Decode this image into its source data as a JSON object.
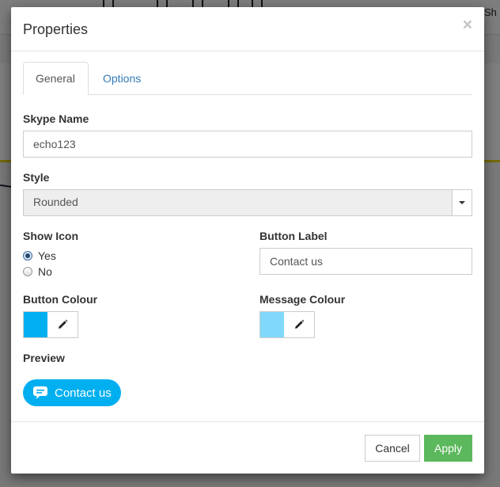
{
  "background": {
    "toolbar_share_text": "Sh"
  },
  "modal": {
    "title": "Properties",
    "close_label": "×",
    "tabs": [
      {
        "label": "General",
        "active": true
      },
      {
        "label": "Options",
        "active": false
      }
    ],
    "skype_name": {
      "label": "Skype Name",
      "value": "echo123"
    },
    "style": {
      "label": "Style",
      "selected": "Rounded"
    },
    "show_icon": {
      "label": "Show Icon",
      "options": [
        {
          "label": "Yes",
          "checked": true
        },
        {
          "label": "No",
          "checked": false
        }
      ]
    },
    "button_label": {
      "label": "Button Label",
      "value": "Contact us"
    },
    "button_colour": {
      "label": "Button Colour",
      "color": "#00aff0"
    },
    "message_colour": {
      "label": "Message Colour",
      "color": "#80d8fa"
    },
    "preview": {
      "label": "Preview",
      "button_text": "Contact us",
      "button_color": "#00aff0"
    },
    "footer": {
      "cancel_label": "Cancel",
      "apply_label": "Apply",
      "apply_color": "#5cb85c"
    }
  }
}
